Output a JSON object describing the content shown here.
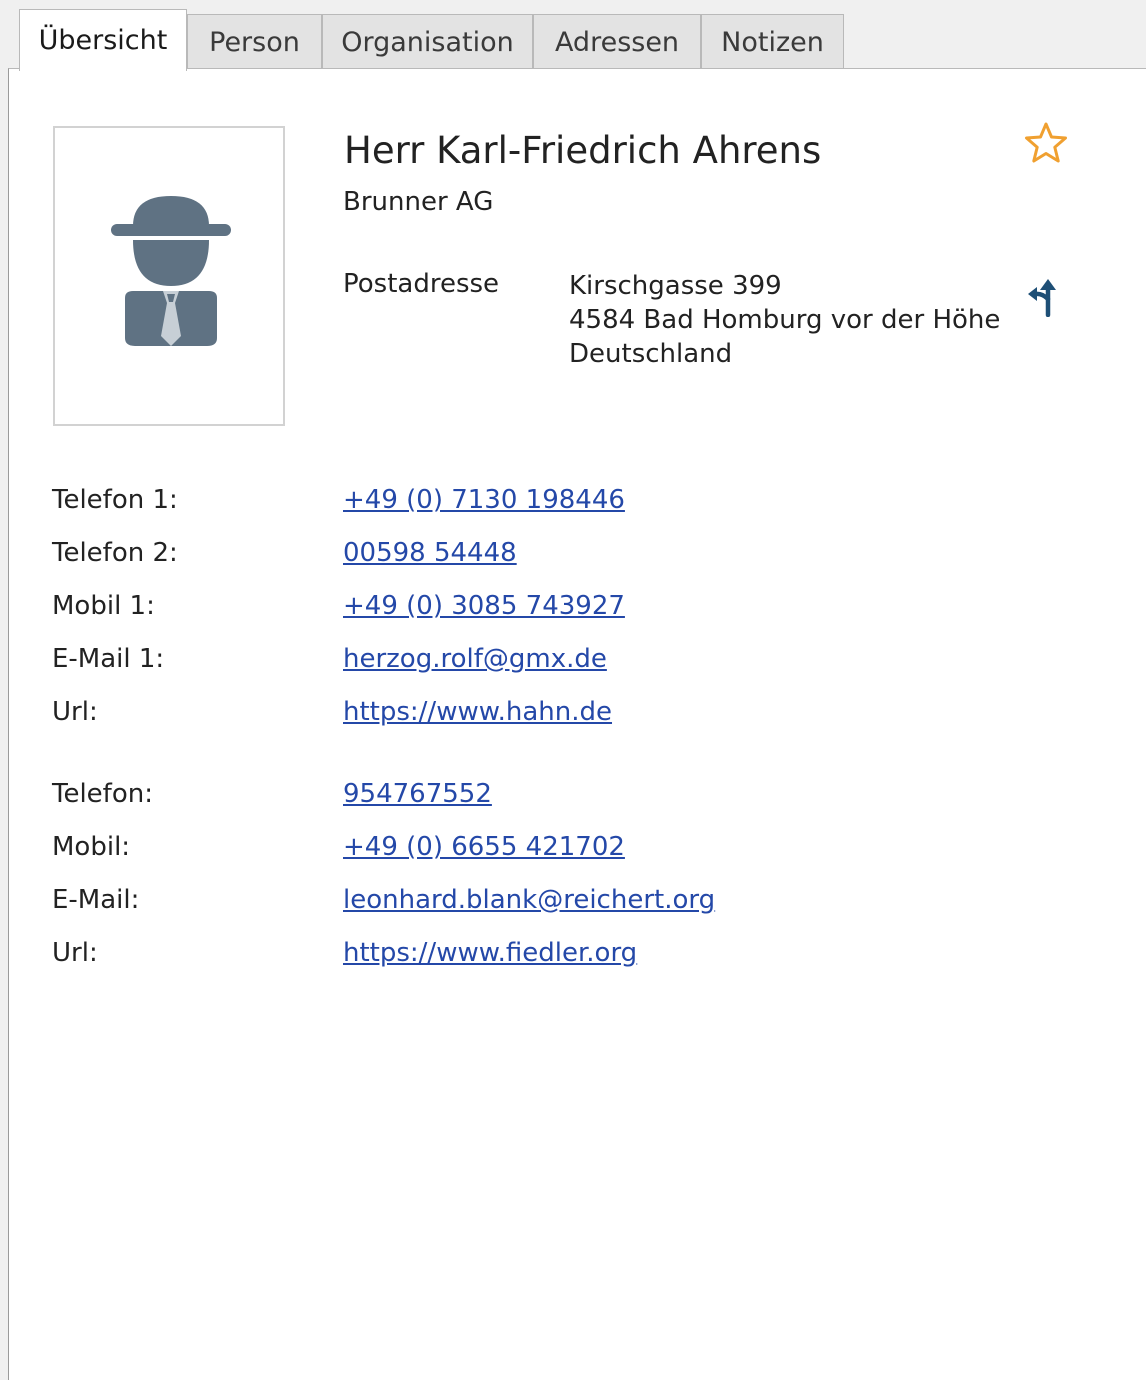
{
  "tabs": [
    {
      "label": "Übersicht",
      "active": true
    },
    {
      "label": "Person",
      "active": false
    },
    {
      "label": "Organisation",
      "active": false
    },
    {
      "label": "Adressen",
      "active": false
    },
    {
      "label": "Notizen",
      "active": false
    }
  ],
  "contact": {
    "name": "Herr Karl-Friedrich Ahrens",
    "company": "Brunner AG",
    "address_label": "Postadresse",
    "address_lines": [
      "Kirschgasse 399",
      "4584 Bad Homburg vor der Höhe",
      "Deutschland"
    ]
  },
  "person_details": [
    {
      "label": "Telefon 1:",
      "value": "+49 (0) 7130 198446"
    },
    {
      "label": "Telefon 2:",
      "value": "00598 54448"
    },
    {
      "label": "Mobil 1:",
      "value": "+49 (0) 3085 743927"
    },
    {
      "label": "E-Mail 1:",
      "value": "herzog.rolf@gmx.de"
    },
    {
      "label": "Url:",
      "value": "https://www.hahn.de"
    }
  ],
  "organisation_details": [
    {
      "label": "Telefon:",
      "value": "954767552"
    },
    {
      "label": "Mobil:",
      "value": "+49 (0) 6655 421702"
    },
    {
      "label": "E-Mail:",
      "value": "leonhard.blank@reichert.org"
    },
    {
      "label": "Url:",
      "value": "https://www.fiedler.org"
    }
  ],
  "icons": {
    "avatar": "person-with-hat-icon",
    "favorite": "star-outline-icon",
    "route": "route-directions-icon"
  },
  "colors": {
    "link": "#2448a8",
    "star": "#f0a030",
    "avatar": "#5f7283",
    "route": "#1e4f76"
  }
}
